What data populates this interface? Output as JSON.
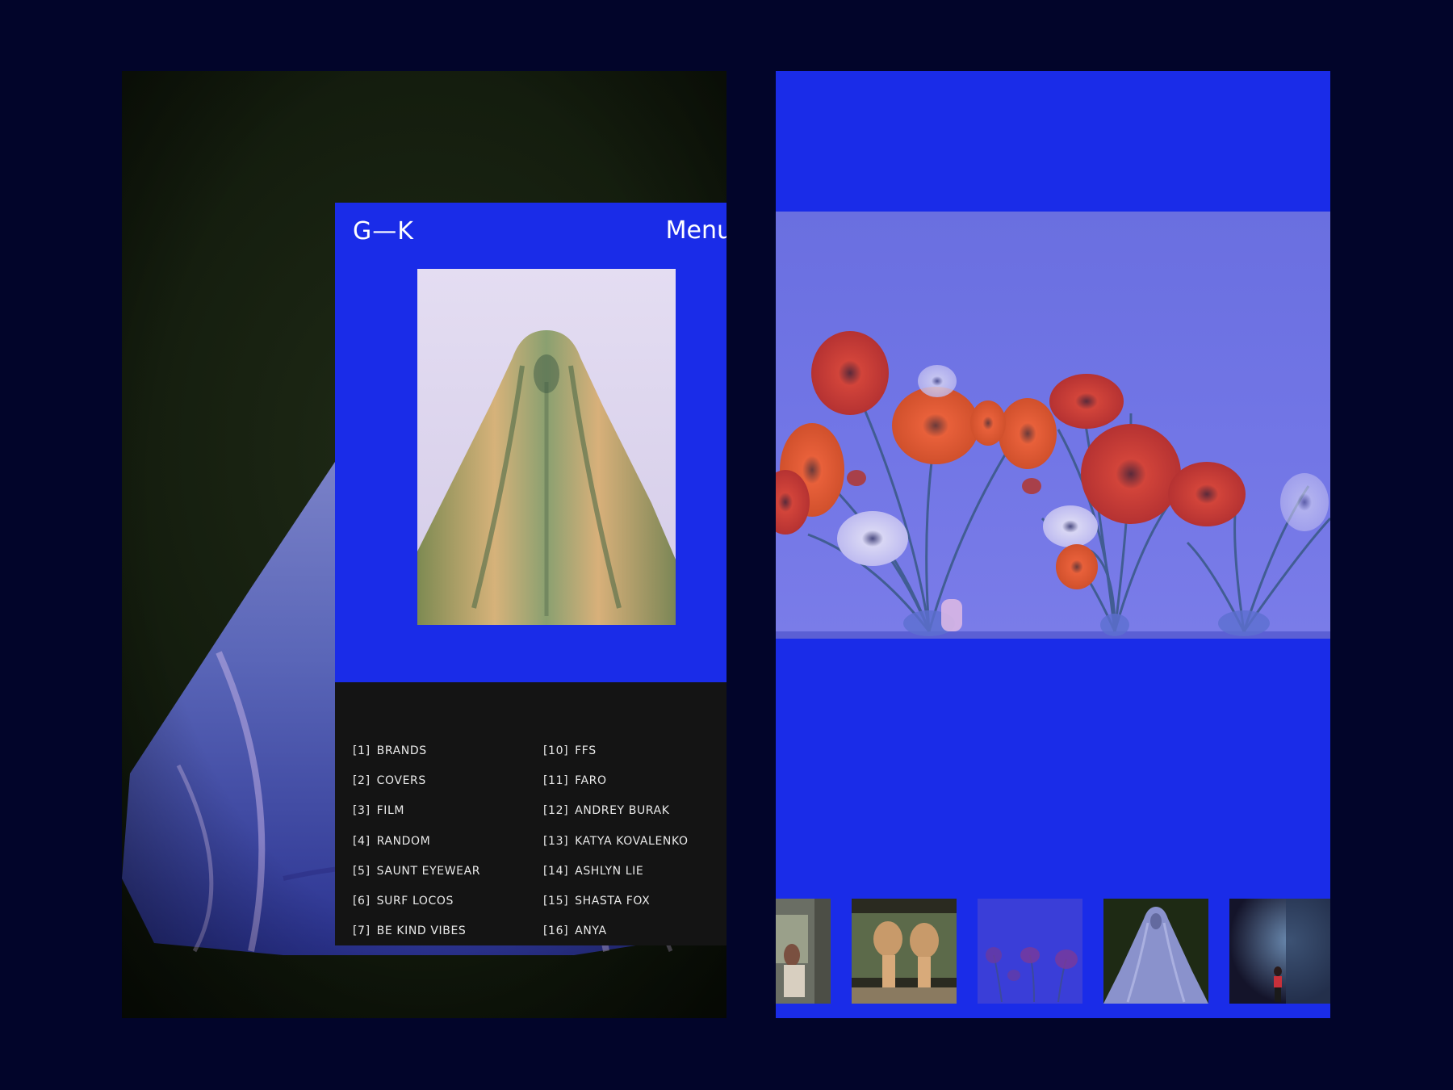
{
  "site": {
    "logo": "G—K",
    "menu_label": "Menu",
    "menu_plus": "+"
  },
  "projects": {
    "col_a": [
      {
        "num": "[1]",
        "name": "BRANDS"
      },
      {
        "num": "[2]",
        "name": "COVERS"
      },
      {
        "num": "[3]",
        "name": "FILM"
      },
      {
        "num": "[4]",
        "name": "RANDOM"
      },
      {
        "num": "[5]",
        "name": "SAUNT EYEWEAR"
      },
      {
        "num": "[6]",
        "name": "SURF LOCOS"
      },
      {
        "num": "[7]",
        "name": "BE KIND VIBES"
      }
    ],
    "col_b": [
      {
        "num": "[10]",
        "name": "FFS"
      },
      {
        "num": "[11]",
        "name": "FARO"
      },
      {
        "num": "[12]",
        "name": "ANDREY BURAK"
      },
      {
        "num": "[13]",
        "name": "KATYA KOVALENKO"
      },
      {
        "num": "[14]",
        "name": "ASHLYN LIE"
      },
      {
        "num": "[15]",
        "name": "SHASTA FOX"
      },
      {
        "num": "[16]",
        "name": "ANYA"
      }
    ]
  },
  "colors": {
    "page_bg": "#02052a",
    "accent_blue": "#1a2ce8",
    "menu_panel": "#141414"
  }
}
